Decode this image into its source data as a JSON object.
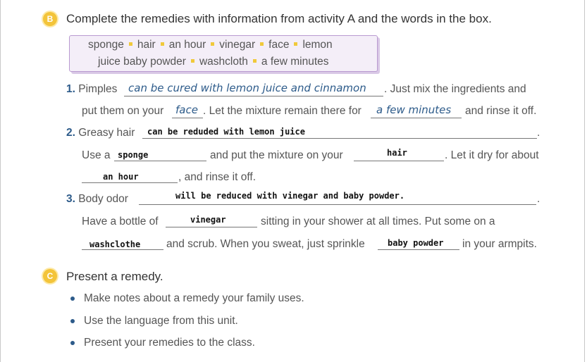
{
  "sectionB": {
    "badge": "B",
    "heading": "Complete the remedies with information from activity A and the words in the box.",
    "words_row1": [
      "sponge",
      "hair",
      "an hour",
      "vinegar",
      "face",
      "lemon"
    ],
    "words_row2": [
      "juice baby powder",
      "washcloth",
      "a few minutes"
    ]
  },
  "item1": {
    "number": "1.",
    "t1": "Pimples",
    "hand1": "can be cured with lemon juice and cinnamon",
    "t2": ". Just mix the ingredients and",
    "t3": "put them on your",
    "hand2": "face",
    "t4": ". Let the mixture remain there for",
    "hand3": "a few minutes",
    "t5": "and rinse it off."
  },
  "item2": {
    "number": "2.",
    "t1": "Greasy hair",
    "ans1": "can be reduded with lemon juice",
    "t2": ".",
    "t3": "Use a",
    "ans2": "sponge",
    "t4": "and put the mixture on your",
    "ans3": "hair",
    "t5": ". Let it dry for about",
    "ans4": "an hour",
    "t6": ", and rinse it off."
  },
  "item3": {
    "number": "3.",
    "t1": "Body odor",
    "ans1": "will be reduced with vinegar and baby powder.",
    "t2": ".",
    "t3": "Have a bottle of",
    "ans2": "vinegar",
    "t4": "sitting in your shower at all times. Put some on a",
    "ans3": "washclothe",
    "t5": "and scrub. When you sweat, just sprinkle",
    "ans4": "baby powder",
    "t6": "in your armpits."
  },
  "sectionC": {
    "badge": "C",
    "heading": "Present a remedy.",
    "bullets": [
      "Make notes about a remedy your family uses.",
      "Use the language from this unit.",
      "Present your remedies to the class."
    ]
  },
  "colors": {
    "accent_yellow": "#f3c43a",
    "number_blue": "#2d5b8a",
    "box_border": "#b99ad0"
  }
}
